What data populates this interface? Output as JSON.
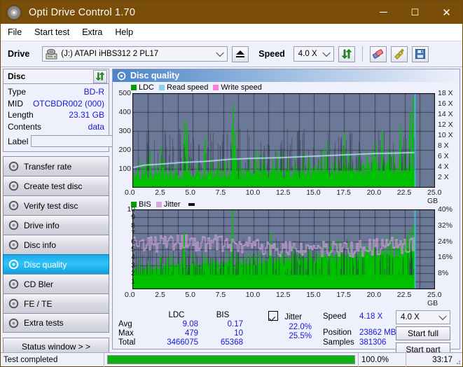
{
  "window": {
    "title": "Opti Drive Control 1.70",
    "icon": "disc-icon",
    "minimize": "─",
    "maximize": "☐",
    "close": "✕"
  },
  "menu": {
    "items": [
      "File",
      "Start test",
      "Extra",
      "Help"
    ]
  },
  "toolbar": {
    "drive_label": "Drive",
    "drive_value": "(J:)   ATAPI iHBS312   2 PL17",
    "eject_title": "eject-button",
    "speed_label": "Speed",
    "speed_value": "4.0 X",
    "icons": [
      "refresh-icon",
      "eraser-icon",
      "plug-icon",
      "save-icon"
    ]
  },
  "disc": {
    "header": "Disc",
    "refresh_icon": "refresh-icon",
    "rows": [
      {
        "key": "Type",
        "value": "BD-R"
      },
      {
        "key": "MID",
        "value": "OTCBDR002 (000)"
      },
      {
        "key": "Length",
        "value": "23.31 GB"
      },
      {
        "key": "Contents",
        "value": "data"
      }
    ],
    "label_key": "Label",
    "label_value": "",
    "label_placeholder": ""
  },
  "sidebar": {
    "items": [
      {
        "label": "Transfer rate",
        "selected": false
      },
      {
        "label": "Create test disc",
        "selected": false
      },
      {
        "label": "Verify test disc",
        "selected": false
      },
      {
        "label": "Drive info",
        "selected": false
      },
      {
        "label": "Disc info",
        "selected": false
      },
      {
        "label": "Disc quality",
        "selected": true
      },
      {
        "label": "CD Bler",
        "selected": false
      },
      {
        "label": "FE / TE",
        "selected": false
      },
      {
        "label": "Extra tests",
        "selected": false
      }
    ],
    "status_window": "Status window > >"
  },
  "content": {
    "title": "Disc quality",
    "title_icon": "disc-quality-icon"
  },
  "chart_data": [
    {
      "type": "line",
      "name": "top-chart",
      "title": "",
      "xlabel": "GB",
      "ylabel": "",
      "legend": [
        {
          "label": "LDC",
          "color": "#00a000"
        },
        {
          "label": "Read speed",
          "color": "#8ad3f0"
        },
        {
          "label": "Write speed",
          "color": "#ff7edc"
        }
      ],
      "legend_position": "top-left",
      "grid": true,
      "x": [
        0.0,
        2.5,
        5.0,
        7.5,
        10.0,
        12.5,
        15.0,
        17.5,
        20.0,
        22.5,
        25.0
      ],
      "xlim": [
        0.0,
        25.0
      ],
      "xticks": [
        "0.0",
        "2.5",
        "5.0",
        "7.5",
        "10.0",
        "12.5",
        "15.0",
        "17.5",
        "20.0",
        "22.5",
        "25.0 GB"
      ],
      "ylim": [
        0,
        500
      ],
      "yticks": [
        "100",
        "200",
        "300",
        "400",
        "500"
      ],
      "y2lim": [
        0,
        18
      ],
      "y2ticks": [
        "2 X",
        "4 X",
        "6 X",
        "8 X",
        "10 X",
        "12 X",
        "14 X",
        "16 X",
        "18 X"
      ],
      "series": [
        {
          "name": "LDC",
          "color": "#00c000",
          "kind": "spikes",
          "baseline": 35,
          "noise": 45,
          "data_end_x": 23.3,
          "spikes": [
            {
              "x": 0.45,
              "y": 150
            },
            {
              "x": 0.8,
              "y": 128
            },
            {
              "x": 1.15,
              "y": 170
            },
            {
              "x": 1.45,
              "y": 190
            },
            {
              "x": 1.9,
              "y": 120
            },
            {
              "x": 2.35,
              "y": 213
            },
            {
              "x": 2.55,
              "y": 148
            },
            {
              "x": 3.15,
              "y": 126
            },
            {
              "x": 3.6,
              "y": 120
            },
            {
              "x": 4.3,
              "y": 352
            },
            {
              "x": 4.45,
              "y": 322
            },
            {
              "x": 4.7,
              "y": 150
            },
            {
              "x": 5.3,
              "y": 126
            },
            {
              "x": 5.95,
              "y": 264
            },
            {
              "x": 6.4,
              "y": 133
            },
            {
              "x": 7.0,
              "y": 120
            },
            {
              "x": 7.6,
              "y": 140
            },
            {
              "x": 8.3,
              "y": 440
            },
            {
              "x": 8.45,
              "y": 300
            },
            {
              "x": 8.9,
              "y": 150
            },
            {
              "x": 9.6,
              "y": 160
            },
            {
              "x": 10.1,
              "y": 196
            },
            {
              "x": 10.9,
              "y": 162
            },
            {
              "x": 11.6,
              "y": 150
            },
            {
              "x": 12.3,
              "y": 198
            },
            {
              "x": 12.8,
              "y": 156
            },
            {
              "x": 13.6,
              "y": 130
            },
            {
              "x": 14.1,
              "y": 188
            },
            {
              "x": 14.6,
              "y": 170
            },
            {
              "x": 15.4,
              "y": 150
            },
            {
              "x": 16.1,
              "y": 240
            },
            {
              "x": 16.5,
              "y": 136
            },
            {
              "x": 17.0,
              "y": 158
            },
            {
              "x": 17.5,
              "y": 290
            },
            {
              "x": 17.9,
              "y": 180
            },
            {
              "x": 18.7,
              "y": 170
            },
            {
              "x": 19.4,
              "y": 155
            },
            {
              "x": 20.1,
              "y": 232
            },
            {
              "x": 20.6,
              "y": 300
            },
            {
              "x": 21.1,
              "y": 196
            },
            {
              "x": 21.6,
              "y": 190
            },
            {
              "x": 22.1,
              "y": 330
            },
            {
              "x": 22.5,
              "y": 260
            },
            {
              "x": 22.9,
              "y": 400
            },
            {
              "x": 23.15,
              "y": 478
            }
          ]
        },
        {
          "name": "Read speed",
          "color": "#bfe9ff",
          "kind": "step-line",
          "points": [
            {
              "x": 0.0,
              "y": 3.8
            },
            {
              "x": 1.0,
              "y": 4.3
            },
            {
              "x": 2.4,
              "y": 4.5
            },
            {
              "x": 4.0,
              "y": 4.8
            },
            {
              "x": 6.0,
              "y": 5.0
            },
            {
              "x": 8.0,
              "y": 5.4
            },
            {
              "x": 10.0,
              "y": 5.6
            },
            {
              "x": 12.0,
              "y": 5.7
            },
            {
              "x": 14.0,
              "y": 5.9
            },
            {
              "x": 16.0,
              "y": 6.1
            },
            {
              "x": 18.0,
              "y": 6.3
            },
            {
              "x": 20.0,
              "y": 6.5
            },
            {
              "x": 22.0,
              "y": 6.6
            },
            {
              "x": 23.3,
              "y": 6.7
            }
          ]
        }
      ],
      "marker_x": 23.3,
      "marker_color": "#37d0f7"
    },
    {
      "type": "line",
      "name": "bottom-chart",
      "title": "",
      "xlabel": "GB",
      "ylabel": "",
      "legend": [
        {
          "label": "BIS",
          "color": "#00a000"
        },
        {
          "label": "Jitter",
          "color": "#d9a8e0"
        }
      ],
      "legend_position": "top-left",
      "grid": true,
      "xlim": [
        0.0,
        25.0
      ],
      "xticks": [
        "0.0",
        "2.5",
        "5.0",
        "7.5",
        "10.0",
        "12.5",
        "15.0",
        "17.5",
        "20.0",
        "22.5",
        "25.0 GB"
      ],
      "ylim": [
        0,
        10
      ],
      "yticks": [
        "1",
        "2",
        "3",
        "4",
        "5",
        "6",
        "7",
        "8",
        "9",
        "10"
      ],
      "y2lim": [
        0,
        40
      ],
      "y2ticks": [
        "8%",
        "16%",
        "24%",
        "32%",
        "40%"
      ],
      "series": [
        {
          "name": "BIS",
          "color": "#00c000",
          "kind": "spikes",
          "baseline": 2.1,
          "noise": 0.9,
          "data_end_x": 23.3,
          "spikes": [
            {
              "x": 2.3,
              "y": 4.3
            },
            {
              "x": 4.25,
              "y": 7.1
            },
            {
              "x": 4.3,
              "y": 4.6
            },
            {
              "x": 5.9,
              "y": 4.3
            },
            {
              "x": 6.4,
              "y": 4.0
            },
            {
              "x": 8.2,
              "y": 10.0
            },
            {
              "x": 9.4,
              "y": 4.2
            },
            {
              "x": 10.5,
              "y": 4.6
            },
            {
              "x": 11.4,
              "y": 7.0
            },
            {
              "x": 12.4,
              "y": 4.4
            },
            {
              "x": 13.6,
              "y": 4.2
            },
            {
              "x": 14.6,
              "y": 5.0
            },
            {
              "x": 15.8,
              "y": 4.4
            },
            {
              "x": 17.1,
              "y": 4.8
            },
            {
              "x": 18.2,
              "y": 4.3
            },
            {
              "x": 19.4,
              "y": 5.2
            },
            {
              "x": 20.3,
              "y": 4.6
            },
            {
              "x": 21.2,
              "y": 6.0
            },
            {
              "x": 22.0,
              "y": 5.2
            },
            {
              "x": 22.6,
              "y": 6.6
            },
            {
              "x": 23.0,
              "y": 7.4
            },
            {
              "x": 23.2,
              "y": 8.2
            }
          ]
        },
        {
          "name": "Jitter",
          "color": "#d9a8e0",
          "kind": "band",
          "center": 5.5,
          "spread": 1.1,
          "data_end_x": 23.3
        }
      ],
      "marker_x": 23.3,
      "marker_color": "#37d0f7"
    }
  ],
  "stats": {
    "columns": [
      "",
      "LDC",
      "BIS"
    ],
    "jitter_label": "Jitter",
    "jitter_checked": true,
    "rows": [
      {
        "key": "Avg",
        "ldc": "9.08",
        "bis": "0.17",
        "jitter": "22.0%"
      },
      {
        "key": "Max",
        "ldc": "479",
        "bis": "10",
        "jitter": "25.5%"
      },
      {
        "key": "Total",
        "ldc": "3466075",
        "bis": "65368",
        "jitter": ""
      }
    ]
  },
  "controls": {
    "speed_key": "Speed",
    "speed_value": "4.18 X",
    "position_key": "Position",
    "position_value": "23862 MB",
    "samples_key": "Samples",
    "samples_value": "381306",
    "speed_select": "4.0 X",
    "start_full": "Start full",
    "start_part": "Start part"
  },
  "statusbar": {
    "message": "Test completed",
    "progress_text": "100.0%",
    "progress_value": 100,
    "elapsed": "33:17"
  }
}
